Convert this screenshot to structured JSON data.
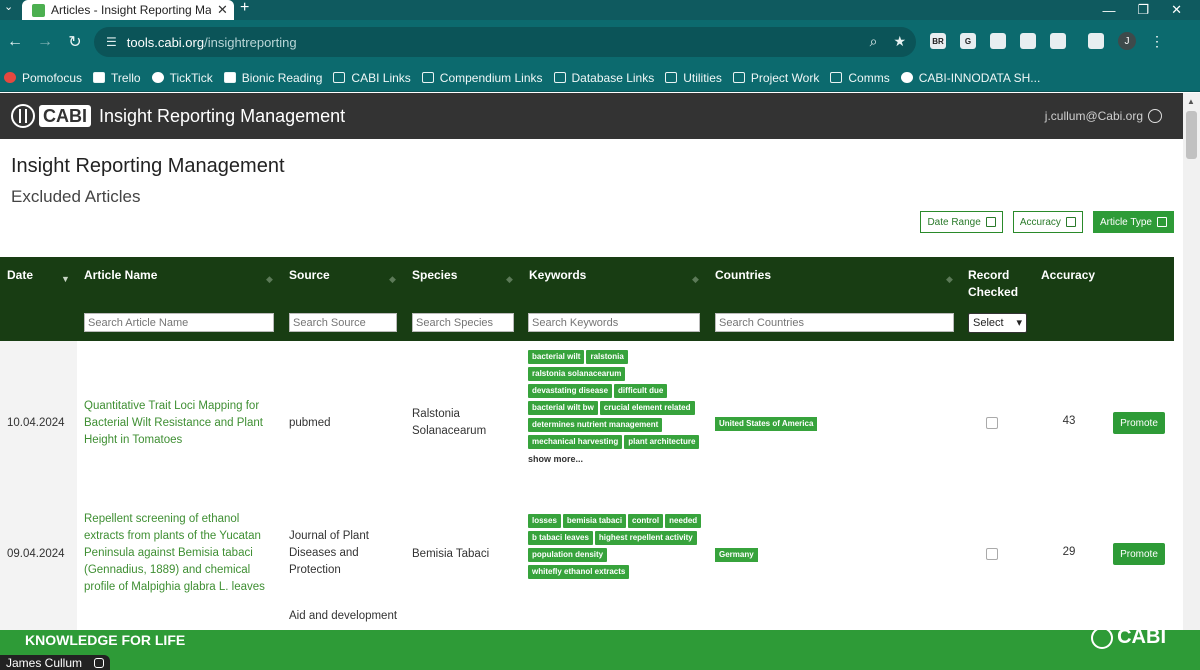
{
  "browser": {
    "tab_title": "Articles - Insight Reporting Mar",
    "url_host": "tools.cabi.org",
    "url_path": "/insightreporting",
    "profile_initial": "J",
    "bookmarks": [
      "Pomofocus",
      "Trello",
      "TickTick",
      "Bionic Reading",
      "CABI Links",
      "Compendium Links",
      "Database Links",
      "Utilities",
      "Project Work",
      "Comms",
      "CABI-INNODATA SH..."
    ]
  },
  "header": {
    "logo_text": "CABI",
    "app_title": "Insight Reporting Management",
    "user_email": "j.cullum@Cabi.org"
  },
  "page": {
    "title": "Insight Reporting Management",
    "subtitle": "Excluded Articles",
    "filters": {
      "date_range": "Date Range",
      "accuracy": "Accuracy",
      "article_type": "Article Type"
    }
  },
  "table": {
    "columns": {
      "date": "Date",
      "article_name": "Article Name",
      "source": "Source",
      "species": "Species",
      "keywords": "Keywords",
      "countries": "Countries",
      "record_checked_1": "Record",
      "record_checked_2": "Checked",
      "accuracy": "Accuracy"
    },
    "placeholders": {
      "article_name": "Search Article Name",
      "source": "Search Source",
      "species": "Search Species",
      "keywords": "Search Keywords",
      "countries": "Search Countries"
    },
    "select_value": "Select",
    "promote_label": "Promote",
    "show_more": "show more...",
    "rows": [
      {
        "date": "10.04.2024",
        "article_lines": [
          "Quantitative Trait Loci Mapping for",
          "Bacterial Wilt Resistance and Plant",
          "Height in Tomatoes"
        ],
        "source_lines": [
          "pubmed"
        ],
        "species_lines": [
          "Ralstonia",
          "Solanacearum"
        ],
        "keywords": [
          "bacterial wilt",
          "ralstonia",
          "ralstonia solanacearum",
          "devastating disease",
          "difficult due",
          "bacterial wilt bw",
          "crucial element related",
          "determines nutrient management",
          "mechanical harvesting",
          "plant architecture"
        ],
        "country": "United States of America",
        "accuracy": "43"
      },
      {
        "date": "09.04.2024",
        "article_lines": [
          "Repellent screening of ethanol",
          "extracts from plants of the Yucatan",
          "Peninsula against Bemisia tabaci",
          "(Gennadius, 1889) and chemical",
          "profile of Malpighia glabra L. leaves"
        ],
        "source_lines": [
          "Journal of Plant",
          "Diseases and",
          "Protection"
        ],
        "species_lines": [
          "Bemisia Tabaci"
        ],
        "keywords": [
          "losses",
          "bemisia tabaci",
          "control",
          "needed",
          "b tabaci leaves",
          "highest repellent activity",
          "population density",
          "whitefly ethanol extracts"
        ],
        "country": "Germany",
        "accuracy": "29"
      },
      {
        "source_lines": [
          "Aid and development"
        ]
      }
    ]
  },
  "footer": {
    "tagline": "KNOWLEDGE FOR LIFE",
    "logo_text": "CABI"
  },
  "presenter": {
    "name": "James Cullum"
  }
}
